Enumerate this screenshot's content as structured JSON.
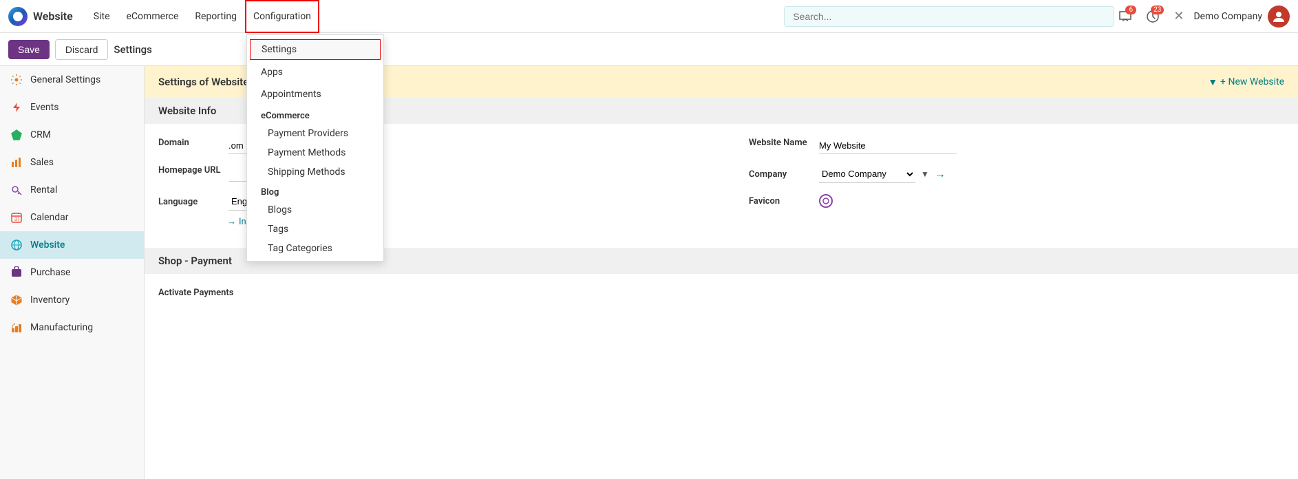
{
  "topnav": {
    "brand": "Website",
    "items": [
      {
        "id": "site",
        "label": "Site"
      },
      {
        "id": "ecommerce",
        "label": "eCommerce"
      },
      {
        "id": "reporting",
        "label": "Reporting"
      },
      {
        "id": "configuration",
        "label": "Configuration",
        "active": true
      }
    ],
    "badge_messages": "6",
    "badge_clock": "23",
    "company": "Demo Company"
  },
  "toolbar": {
    "save_label": "Save",
    "discard_label": "Discard",
    "title": "Settings"
  },
  "search": {
    "placeholder": "Search..."
  },
  "sidebar": {
    "items": [
      {
        "id": "general-settings",
        "label": "General Settings",
        "icon": "gear"
      },
      {
        "id": "events",
        "label": "Events",
        "icon": "lightning"
      },
      {
        "id": "crm",
        "label": "CRM",
        "icon": "diamond"
      },
      {
        "id": "sales",
        "label": "Sales",
        "icon": "bar-chart"
      },
      {
        "id": "rental",
        "label": "Rental",
        "icon": "key"
      },
      {
        "id": "calendar",
        "label": "Calendar",
        "icon": "calendar"
      },
      {
        "id": "website",
        "label": "Website",
        "icon": "globe",
        "active": true
      },
      {
        "id": "purchase",
        "label": "Purchase",
        "icon": "purchase"
      },
      {
        "id": "inventory",
        "label": "Inventory",
        "icon": "inventory"
      },
      {
        "id": "manufacturing",
        "label": "Manufacturing",
        "icon": "manufacturing"
      }
    ]
  },
  "dropdown": {
    "items": [
      {
        "id": "settings",
        "label": "Settings",
        "highlighted": true
      },
      {
        "id": "apps",
        "label": "Apps"
      },
      {
        "id": "appointments",
        "label": "Appointments"
      }
    ],
    "sections": [
      {
        "label": "eCommerce",
        "items": [
          {
            "id": "payment-providers",
            "label": "Payment Providers"
          },
          {
            "id": "payment-methods",
            "label": "Payment Methods"
          },
          {
            "id": "shipping-methods",
            "label": "Shipping Methods"
          }
        ]
      },
      {
        "label": "Blog",
        "items": [
          {
            "id": "blogs",
            "label": "Blogs"
          },
          {
            "id": "tags",
            "label": "Tags"
          },
          {
            "id": "tag-categories",
            "label": "Tag Categories"
          }
        ]
      }
    ]
  },
  "content": {
    "settings_of_website": "Settings of Website",
    "new_website_btn": "+ New Website",
    "website_info_title": "Website Info",
    "domain_label": "Domain",
    "domain_value": ".om",
    "homepage_url_label": "Homepage URL",
    "language_label": "Language",
    "website_name_label": "Website Name",
    "website_name_value": "My Website",
    "company_label": "Company",
    "company_value": "Demo Company",
    "favicon_label": "Favicon",
    "install_languages": "Install languages",
    "shop_payment_title": "Shop - Payment",
    "activate_payments_label": "Activate Payments"
  }
}
